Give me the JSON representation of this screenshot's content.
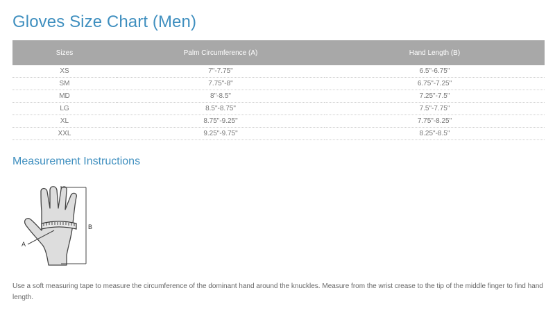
{
  "page": {
    "title": "Gloves Size Chart (Men)"
  },
  "table": {
    "headers": [
      "Sizes",
      "Palm Circumference (A)",
      "Hand Length (B)"
    ],
    "rows": [
      [
        "XS",
        "7\"-7.75\"",
        "6.5\"-6.75\""
      ],
      [
        "SM",
        "7.75\"-8\"",
        "6.75\"-7.25\""
      ],
      [
        "MD",
        "8\"-8.5\"",
        "7.25\"-7.5\""
      ],
      [
        "LG",
        "8.5\"-8.75\"",
        "7.5\"-7.75\""
      ],
      [
        "XL",
        "8.75\"-9.25\"",
        "7.75\"-8.25\""
      ],
      [
        "XXL",
        "9.25\"-9.75\"",
        "8.25\"-8.5\""
      ]
    ]
  },
  "measurement": {
    "title": "Measurement Instructions",
    "label_a": "A",
    "label_b": "B",
    "text": "Use a soft measuring tape to measure the circumference of the dominant hand around the knuckles. Measure from the wrist crease to the tip of the middle finger to find hand length."
  },
  "colors": {
    "accent": "#3f8fbf",
    "header_bg": "#a8a8a8"
  }
}
